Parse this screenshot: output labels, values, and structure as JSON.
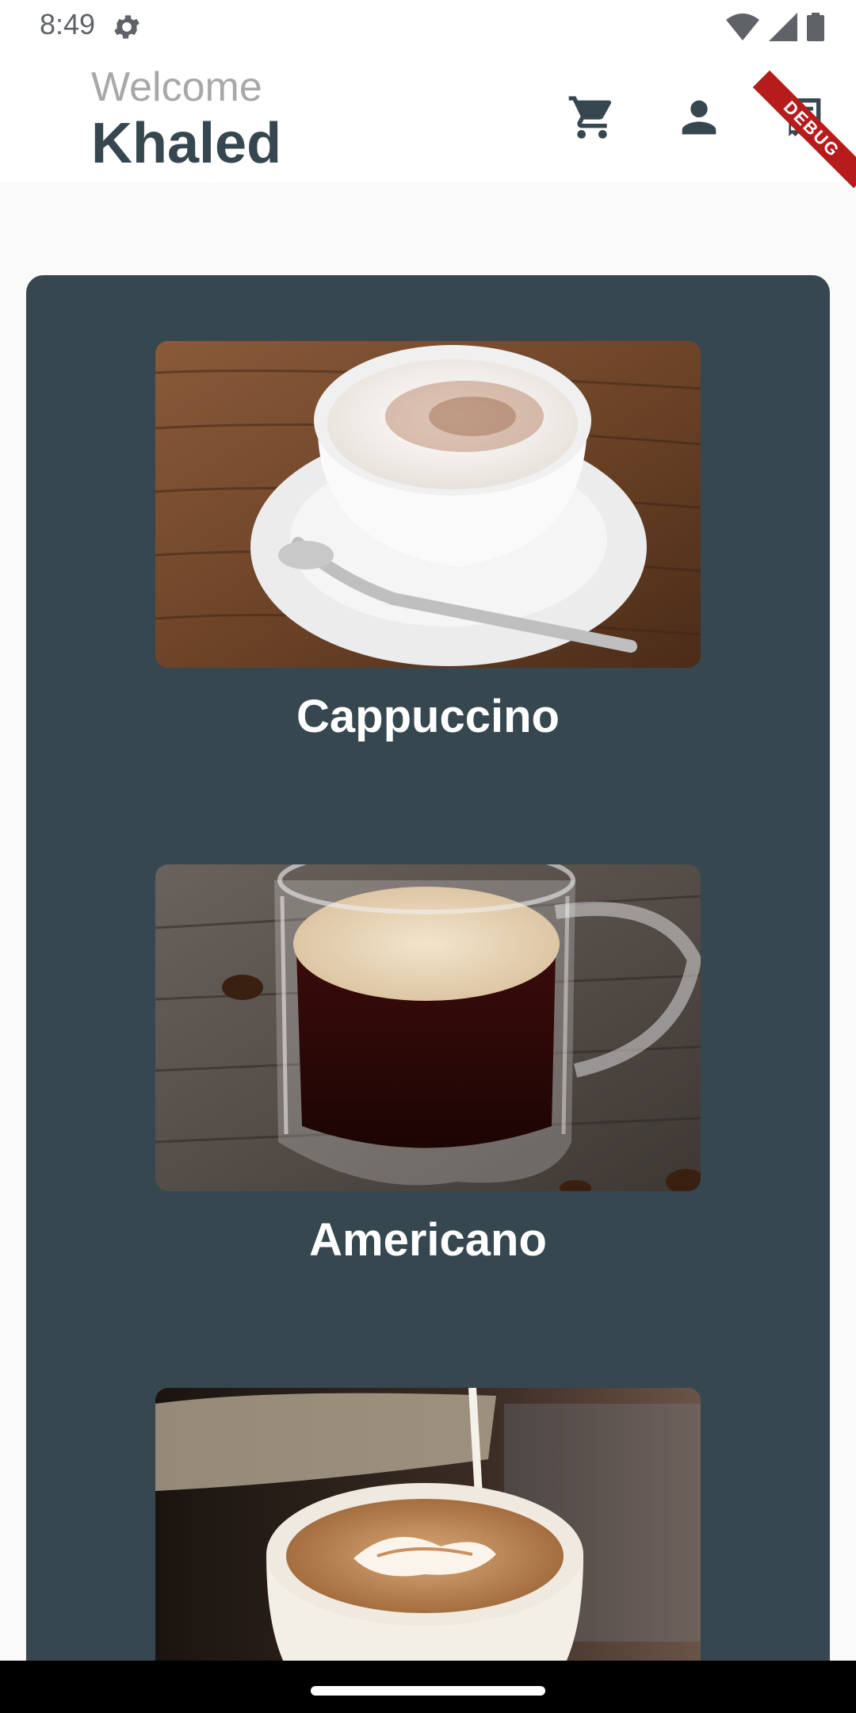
{
  "status_bar": {
    "time": "8:49"
  },
  "header": {
    "welcome_text": "Welcome",
    "username": "Khaled",
    "debug_banner": "DEBUG"
  },
  "menu": {
    "items": [
      {
        "label": "Cappuccino"
      },
      {
        "label": "Americano"
      },
      {
        "label": ""
      }
    ]
  },
  "colors": {
    "primary": "#37474f",
    "welcome_gray": "#a8a8a8",
    "debug_banner": "#b71c1c"
  }
}
